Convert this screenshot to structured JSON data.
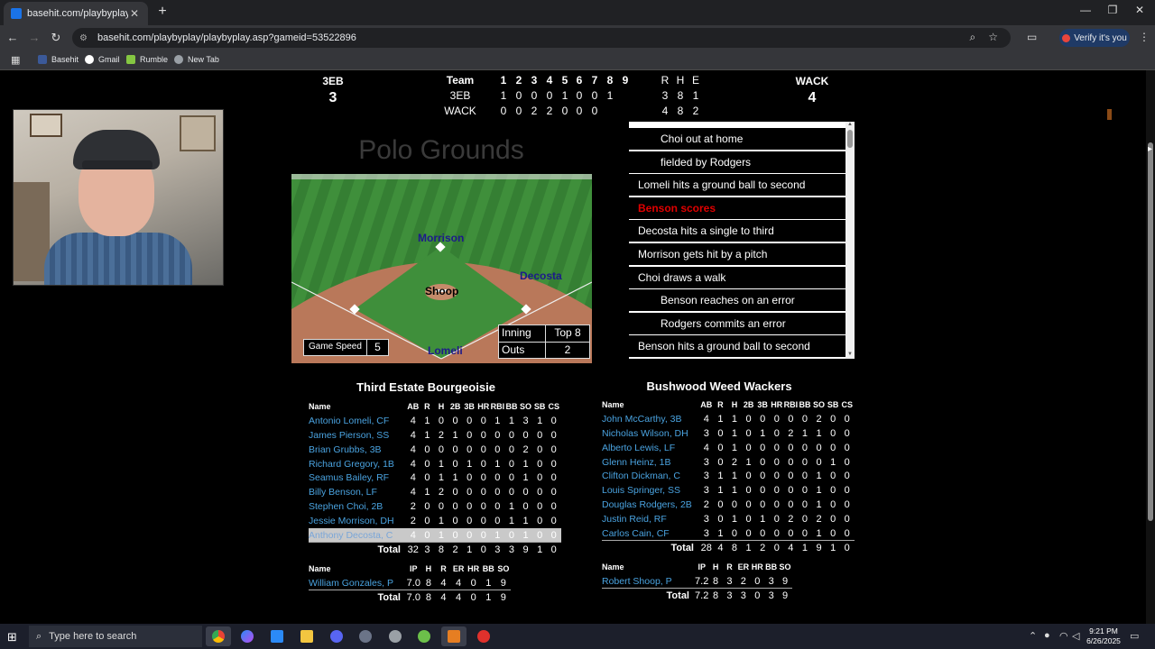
{
  "browser": {
    "tab_title": "basehit.com/playbyplay/playby",
    "tab_close": "✕",
    "new_tab": "+",
    "url": "basehit.com/playbyplay/playbyplay.asp?gameid=53522896",
    "verify_label": "Verify it's you",
    "window_controls": [
      "—",
      "❐",
      "✕"
    ],
    "bookmarks": [
      {
        "label": "Basehit",
        "color": "#3b5998"
      },
      {
        "label": "Gmail",
        "color": "#ffffff"
      },
      {
        "label": "Rumble",
        "color": "#85c742"
      },
      {
        "label": "New Tab",
        "color": "#9aa0a6"
      }
    ]
  },
  "scoreboard": {
    "away_abbr": "3EB",
    "away_score": "3",
    "home_abbr": "WACK",
    "home_score": "4",
    "team_header": "Team",
    "innings": [
      "1",
      "2",
      "3",
      "4",
      "5",
      "6",
      "7",
      "8",
      "9"
    ],
    "rhe_header": [
      "R",
      "H",
      "E"
    ],
    "rows": [
      {
        "team": "3EB",
        "innings": [
          "1",
          "0",
          "0",
          "0",
          "1",
          "0",
          "0",
          "1",
          ""
        ],
        "rhe": [
          "3",
          "8",
          "1"
        ]
      },
      {
        "team": "WACK",
        "innings": [
          "0",
          "0",
          "2",
          "2",
          "0",
          "0",
          "0",
          "",
          ""
        ],
        "rhe": [
          "4",
          "8",
          "2"
        ]
      }
    ]
  },
  "stadium": "Polo Grounds",
  "field": {
    "players": {
      "second": "Morrison",
      "first": "Decosta",
      "mound": "Shoop",
      "home": "Lomeli"
    },
    "game_speed_label": "Game Speed",
    "game_speed": "5",
    "inning_label": "Inning",
    "inning": "Top 8",
    "outs_label": "Outs",
    "outs": "2"
  },
  "play_by_play": [
    {
      "text": "Choi out at home",
      "indent": true,
      "score": false
    },
    {
      "text": "fielded by Rodgers",
      "indent": true,
      "score": false
    },
    {
      "text": "Lomeli hits a ground ball to second",
      "indent": false,
      "score": false
    },
    {
      "text": "Benson scores",
      "indent": false,
      "score": true
    },
    {
      "text": "Decosta hits a single to third",
      "indent": false,
      "score": false
    },
    {
      "text": "Morrison gets hit by a pitch",
      "indent": false,
      "score": false
    },
    {
      "text": "Choi draws a walk",
      "indent": false,
      "score": false
    },
    {
      "text": "Benson reaches on an error",
      "indent": true,
      "score": false
    },
    {
      "text": "Rodgers commits an error",
      "indent": true,
      "score": false
    },
    {
      "text": "Benson hits a ground ball to second",
      "indent": false,
      "score": false
    }
  ],
  "away_box": {
    "team_name": "Third Estate Bourgeoisie",
    "batting_headers": [
      "Name",
      "AB",
      "R",
      "H",
      "2B",
      "3B",
      "HR",
      "RBI",
      "BB",
      "SO",
      "SB",
      "CS"
    ],
    "batters": [
      {
        "name": "Antonio Lomeli, CF",
        "stats": [
          "4",
          "1",
          "0",
          "0",
          "0",
          "0",
          "1",
          "1",
          "3",
          "1",
          "0"
        ]
      },
      {
        "name": "James Pierson, SS",
        "stats": [
          "4",
          "1",
          "2",
          "1",
          "0",
          "0",
          "0",
          "0",
          "0",
          "0",
          "0"
        ]
      },
      {
        "name": "Brian Grubbs, 3B",
        "stats": [
          "4",
          "0",
          "0",
          "0",
          "0",
          "0",
          "0",
          "0",
          "2",
          "0",
          "0"
        ]
      },
      {
        "name": "Richard Gregory, 1B",
        "stats": [
          "4",
          "0",
          "1",
          "0",
          "1",
          "0",
          "1",
          "0",
          "1",
          "0",
          "0"
        ]
      },
      {
        "name": "Seamus Bailey, RF",
        "stats": [
          "4",
          "0",
          "1",
          "1",
          "0",
          "0",
          "0",
          "0",
          "1",
          "0",
          "0"
        ]
      },
      {
        "name": "Billy Benson, LF",
        "stats": [
          "4",
          "1",
          "2",
          "0",
          "0",
          "0",
          "0",
          "0",
          "0",
          "0",
          "0"
        ]
      },
      {
        "name": "Stephen Choi, 2B",
        "stats": [
          "2",
          "0",
          "0",
          "0",
          "0",
          "0",
          "0",
          "1",
          "0",
          "0",
          "0"
        ]
      },
      {
        "name": "Jessie Morrison, DH",
        "stats": [
          "2",
          "0",
          "1",
          "0",
          "0",
          "0",
          "0",
          "1",
          "1",
          "0",
          "0"
        ]
      },
      {
        "name": "Anthony Decosta, C",
        "stats": [
          "4",
          "0",
          "1",
          "0",
          "0",
          "0",
          "1",
          "0",
          "1",
          "0",
          "0"
        ],
        "highlight": true
      }
    ],
    "batting_total_label": "Total",
    "batting_totals": [
      "32",
      "3",
      "8",
      "2",
      "1",
      "0",
      "3",
      "3",
      "9",
      "1",
      "0"
    ],
    "pitching_headers": [
      "Name",
      "IP",
      "H",
      "R",
      "ER",
      "HR",
      "BB",
      "SO"
    ],
    "pitchers": [
      {
        "name": "William Gonzales, P",
        "stats": [
          "7.0",
          "8",
          "4",
          "4",
          "0",
          "1",
          "9"
        ]
      }
    ],
    "pitching_total_label": "Total",
    "pitching_totals": [
      "7.0",
      "8",
      "4",
      "4",
      "0",
      "1",
      "9"
    ]
  },
  "home_box": {
    "team_name": "Bushwood Weed Wackers",
    "batting_headers": [
      "Name",
      "AB",
      "R",
      "H",
      "2B",
      "3B",
      "HR",
      "RBI",
      "BB",
      "SO",
      "SB",
      "CS"
    ],
    "batters": [
      {
        "name": "John McCarthy, 3B",
        "stats": [
          "4",
          "1",
          "1",
          "0",
          "0",
          "0",
          "0",
          "0",
          "2",
          "0",
          "0"
        ]
      },
      {
        "name": "Nicholas Wilson, DH",
        "stats": [
          "3",
          "0",
          "1",
          "0",
          "1",
          "0",
          "2",
          "1",
          "1",
          "0",
          "0"
        ]
      },
      {
        "name": "Alberto Lewis, LF",
        "stats": [
          "4",
          "0",
          "1",
          "0",
          "0",
          "0",
          "0",
          "0",
          "0",
          "0",
          "0"
        ]
      },
      {
        "name": "Glenn Heinz, 1B",
        "stats": [
          "3",
          "0",
          "2",
          "1",
          "0",
          "0",
          "0",
          "0",
          "0",
          "1",
          "0"
        ]
      },
      {
        "name": "Clifton Dickman, C",
        "stats": [
          "3",
          "1",
          "1",
          "0",
          "0",
          "0",
          "0",
          "0",
          "1",
          "0",
          "0"
        ]
      },
      {
        "name": "Louis Springer, SS",
        "stats": [
          "3",
          "1",
          "1",
          "0",
          "0",
          "0",
          "0",
          "0",
          "1",
          "0",
          "0"
        ]
      },
      {
        "name": "Douglas Rodgers, 2B",
        "stats": [
          "2",
          "0",
          "0",
          "0",
          "0",
          "0",
          "0",
          "0",
          "1",
          "0",
          "0"
        ]
      },
      {
        "name": "Justin Reid, RF",
        "stats": [
          "3",
          "0",
          "1",
          "0",
          "1",
          "0",
          "2",
          "0",
          "2",
          "0",
          "0"
        ]
      },
      {
        "name": "Carlos Cain, CF",
        "stats": [
          "3",
          "1",
          "0",
          "0",
          "0",
          "0",
          "0",
          "0",
          "1",
          "0",
          "0"
        ]
      }
    ],
    "batting_total_label": "Total",
    "batting_totals": [
      "28",
      "4",
      "8",
      "1",
      "2",
      "0",
      "4",
      "1",
      "9",
      "1",
      "0"
    ],
    "pitching_headers": [
      "Name",
      "IP",
      "H",
      "R",
      "ER",
      "HR",
      "BB",
      "SO"
    ],
    "pitchers": [
      {
        "name": "Robert Shoop, P",
        "stats": [
          "7.2",
          "8",
          "3",
          "2",
          "0",
          "3",
          "9"
        ]
      }
    ],
    "pitching_total_label": "Total",
    "pitching_totals": [
      "7.2",
      "8",
      "3",
      "3",
      "0",
      "3",
      "9"
    ]
  },
  "taskbar": {
    "search_placeholder": "Type here to search",
    "time": "9:21 PM",
    "date": "6/26/2025"
  }
}
